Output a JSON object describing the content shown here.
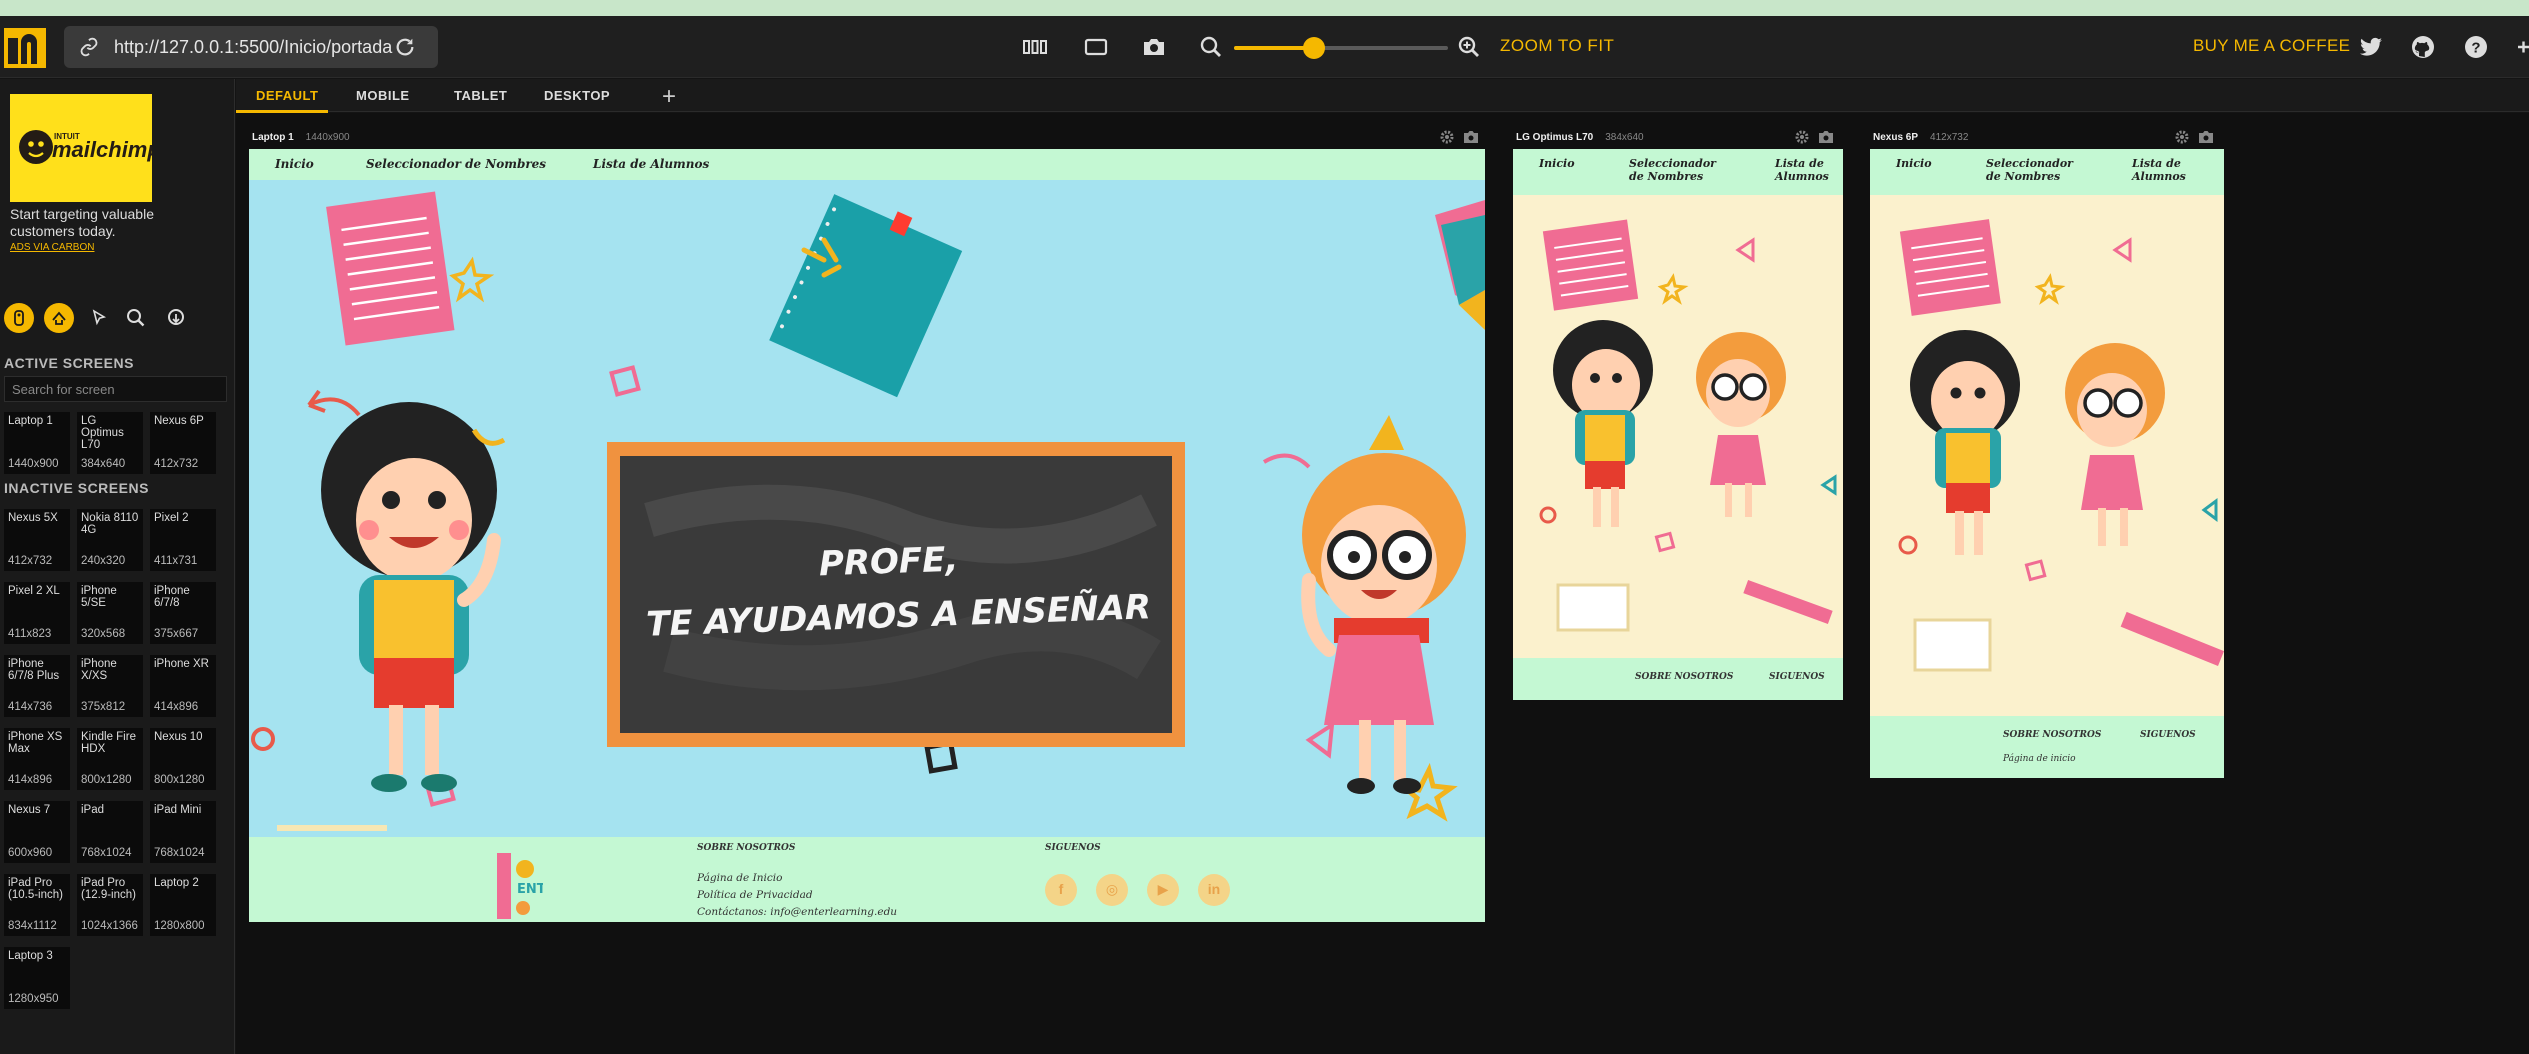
{
  "toolbar": {
    "url": "http://127.0.0.1:5500/Inicio/portada",
    "zoom_fit_label": "ZOOM TO FIT",
    "coffee_label": "BUY ME A COFFEE",
    "zoom_level_fraction": 0.37
  },
  "ad": {
    "brand_top": "INTUIT",
    "brand": "mailchimp",
    "text": "Start targeting valuable customers today.",
    "link": "ADS VIA CARBON"
  },
  "sidebar": {
    "active_title": "ACTIVE SCREENS",
    "search_placeholder": "Search for screen",
    "inactive_title": "INACTIVE SCREENS",
    "active": [
      {
        "name": "Laptop 1",
        "res": "1440x900"
      },
      {
        "name": "LG Optimus L70",
        "res": "384x640"
      },
      {
        "name": "Nexus 6P",
        "res": "412x732"
      }
    ],
    "inactive": [
      {
        "name": "Nexus 5X",
        "res": "412x732"
      },
      {
        "name": "Nokia 8110 4G",
        "res": "240x320"
      },
      {
        "name": "Pixel 2",
        "res": "411x731"
      },
      {
        "name": "Pixel 2 XL",
        "res": "411x823"
      },
      {
        "name": "iPhone 5/SE",
        "res": "320x568"
      },
      {
        "name": "iPhone 6/7/8",
        "res": "375x667"
      },
      {
        "name": "iPhone 6/7/8 Plus",
        "res": "414x736"
      },
      {
        "name": "iPhone X/XS",
        "res": "375x812"
      },
      {
        "name": "iPhone XR",
        "res": "414x896"
      },
      {
        "name": "iPhone XS Max",
        "res": "414x896"
      },
      {
        "name": "Kindle Fire HDX",
        "res": "800x1280"
      },
      {
        "name": "Nexus 10",
        "res": "800x1280"
      },
      {
        "name": "Nexus 7",
        "res": "600x960"
      },
      {
        "name": "iPad",
        "res": "768x1024"
      },
      {
        "name": "iPad Mini",
        "res": "768x1024"
      },
      {
        "name": "iPad Pro (10.5-inch)",
        "res": "834x1112"
      },
      {
        "name": "iPad Pro (12.9-inch)",
        "res": "1024x1366"
      },
      {
        "name": "Laptop 2",
        "res": "1280x800"
      },
      {
        "name": "Laptop 3",
        "res": "1280x950"
      }
    ]
  },
  "tabs": [
    "DEFAULT",
    "MOBILE",
    "TABLET",
    "DESKTOP"
  ],
  "devices": [
    {
      "name": "Laptop 1",
      "res": "1440x900"
    },
    {
      "name": "LG Optimus L70",
      "res": "384x640"
    },
    {
      "name": "Nexus 6P",
      "res": "412x732"
    }
  ],
  "site": {
    "nav": [
      "Inicio",
      "Seleccionador de Nombres",
      "Lista de Alumnos"
    ],
    "nav_mobile": [
      "Inicio",
      "Seleccionador",
      "de Nombres",
      "Lista de",
      "Alumnos"
    ],
    "board_line1": "PROFE,",
    "board_line2": "TE AYUDAMOS A ENSEÑAR",
    "footer_about_title": "SOBRE NOSOTROS",
    "footer_follow_title": "SIGUENOS",
    "footer_links": [
      "Página de Inicio",
      "Política de Privacidad",
      "Contáctanos: info@enterlearning.edu"
    ],
    "footer_partial": "Página de inicio",
    "logo_text": "ENTER",
    "social": [
      "f",
      "◎",
      "▶",
      "in"
    ]
  }
}
